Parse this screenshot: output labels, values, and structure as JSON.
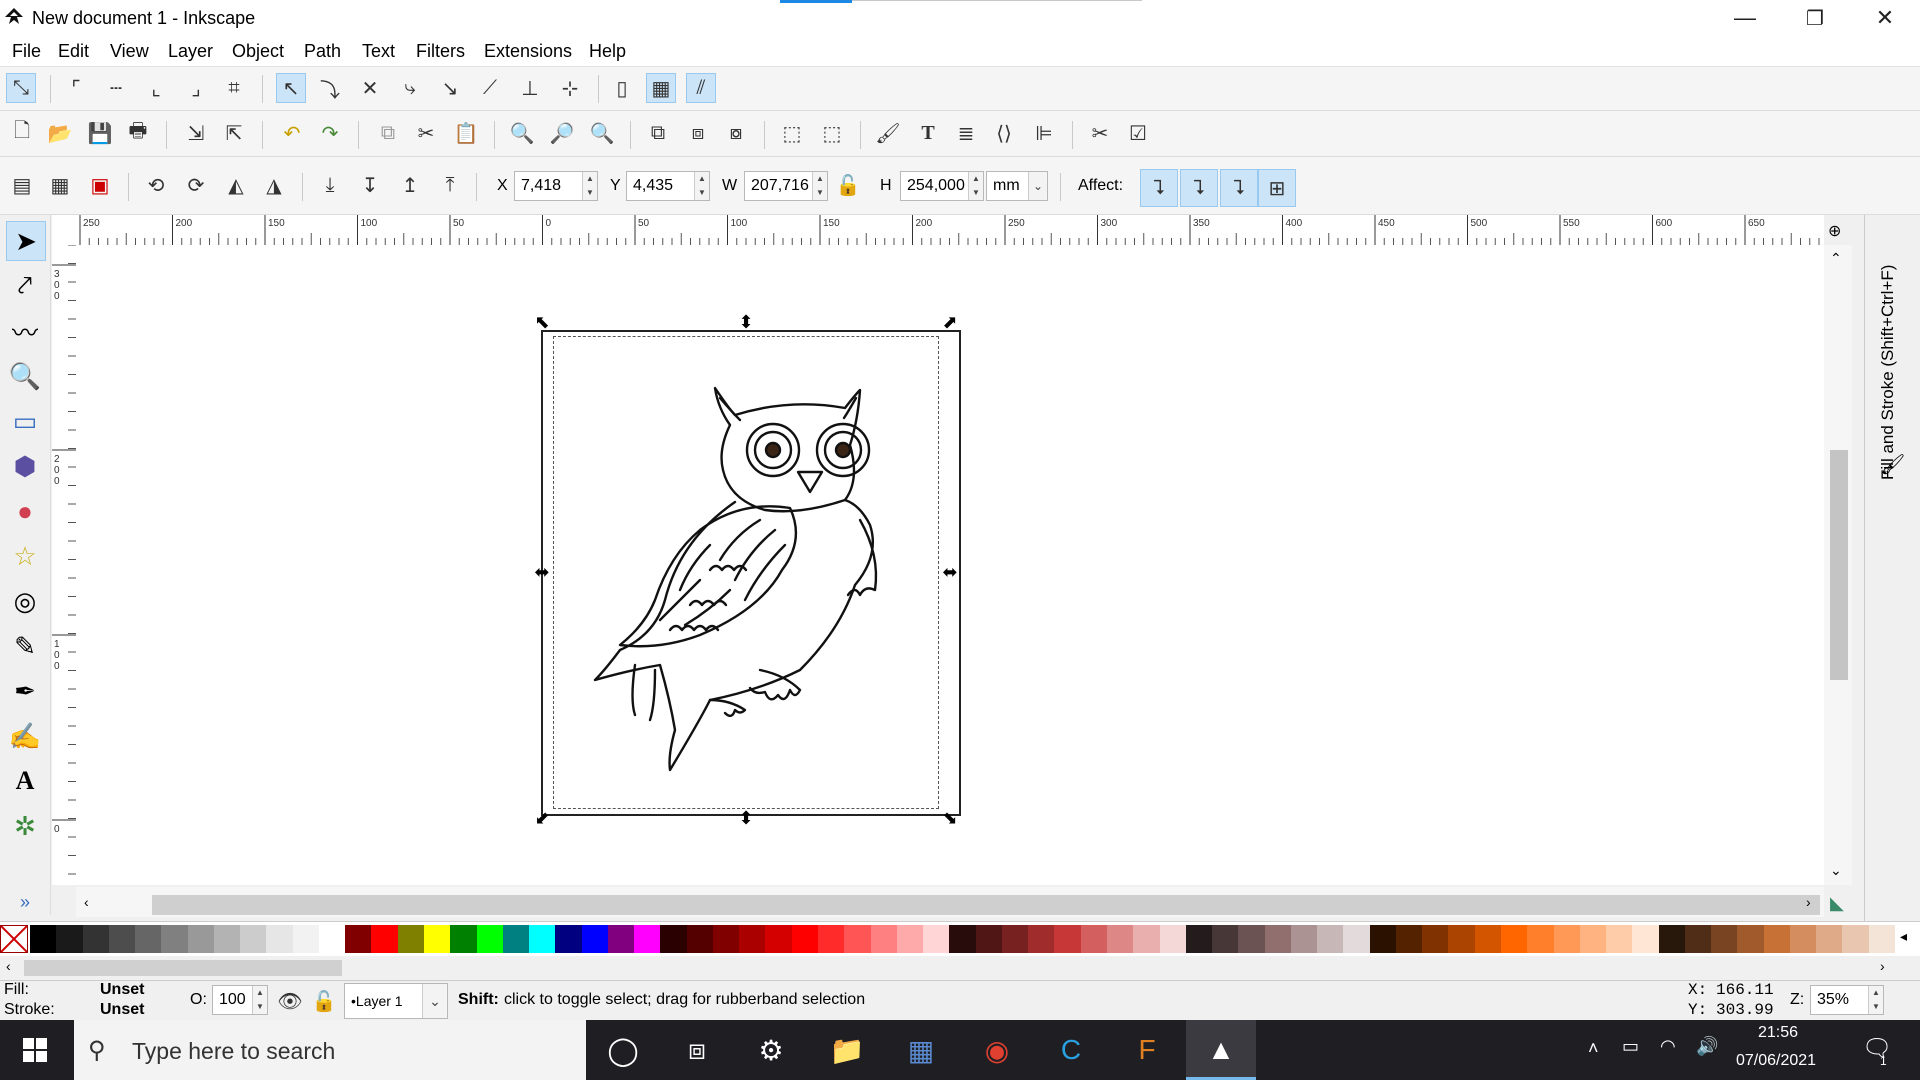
{
  "window": {
    "title": "New document 1 - Inkscape",
    "minimize": "—",
    "restore": "❐",
    "close": "✕"
  },
  "menu": [
    "File",
    "Edit",
    "View",
    "Layer",
    "Object",
    "Path",
    "Text",
    "Filters",
    "Extensions",
    "Help"
  ],
  "select_toolbar": {
    "x_label": "X",
    "x_value": "7,418",
    "y_label": "Y",
    "y_value": "4,435",
    "w_label": "W",
    "w_value": "207,716",
    "h_label": "H",
    "h_value": "254,000",
    "unit": "mm",
    "affect_label": "Affect:"
  },
  "ruler": {
    "h_ticks": [
      "250",
      "200",
      "150",
      "100",
      "50",
      "0",
      "50",
      "100",
      "150",
      "200",
      "250",
      "300",
      "350",
      "400",
      "450",
      "500",
      "550",
      "600",
      "650"
    ],
    "v_ticks": [
      "3 0 0",
      "2 0 0",
      "1 0 0",
      "0"
    ]
  },
  "dock": {
    "panel_label": "Fill and Stroke (Shift+Ctrl+F)"
  },
  "status": {
    "fill_label": "Fill:",
    "fill_value": "Unset",
    "stroke_label": "Stroke:",
    "stroke_value": "Unset",
    "opacity_label": "O:",
    "opacity_value": "100",
    "layer": "•Layer 1",
    "message_bold": "Shift:",
    "message": " click to toggle select; drag for rubberband selection",
    "x_label": "X:",
    "x_value": "166.11",
    "y_label": "Y:",
    "y_value": "303.99",
    "zoom_label": "Z:",
    "zoom_value": "35%"
  },
  "palette": [
    "#000000",
    "#1a1a1a",
    "#333333",
    "#4d4d4d",
    "#666666",
    "#808080",
    "#999999",
    "#b3b3b3",
    "#cccccc",
    "#e6e6e6",
    "#f2f2f2",
    "#ffffff",
    "#800000",
    "#ff0000",
    "#808000",
    "#ffff00",
    "#008000",
    "#00ff00",
    "#008080",
    "#00ffff",
    "#000080",
    "#0000ff",
    "#800080",
    "#ff00ff",
    "#2b0000",
    "#550000",
    "#800000",
    "#aa0000",
    "#d40000",
    "#ff0000",
    "#ff2a2a",
    "#ff5555",
    "#ff8080",
    "#ffaaaa",
    "#ffd5d5",
    "#280b0b",
    "#501616",
    "#782121",
    "#a02c2c",
    "#c83737",
    "#d35f5f",
    "#de8787",
    "#e9afaf",
    "#f4d7d7",
    "#241c1c",
    "#483737",
    "#6c5353",
    "#916f6f",
    "#ac9393",
    "#c8b7b7",
    "#e3dbdb",
    "#2b1100",
    "#552200",
    "#803300",
    "#aa4400",
    "#d45500",
    "#ff6600",
    "#ff7f2a",
    "#ff9955",
    "#ffb380",
    "#ffccaa",
    "#ffe6d5",
    "#28170b",
    "#502d16",
    "#784421",
    "#a05a2c",
    "#c87137",
    "#d38d5f",
    "#deaa87",
    "#e9c6af",
    "#f4e3d7"
  ],
  "taskbar": {
    "search_placeholder": "Type here to search",
    "time": "21:56",
    "date": "07/06/2021",
    "notification_count": "1"
  }
}
